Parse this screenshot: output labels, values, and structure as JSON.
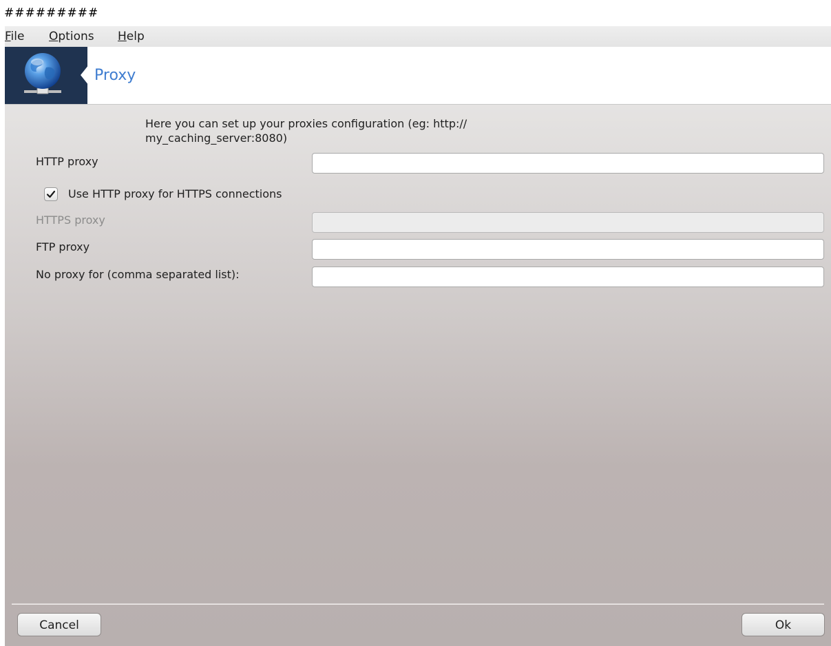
{
  "window_title": "#########",
  "menu": {
    "items": [
      {
        "label": "File",
        "mnemonic": "F"
      },
      {
        "label": "Options",
        "mnemonic": "O"
      },
      {
        "label": "Help",
        "mnemonic": "H"
      }
    ]
  },
  "banner": {
    "title": "Proxy",
    "icon": "network-globe-icon",
    "title_color": "#3f7dd0",
    "icon_bg_color": "#1f3350"
  },
  "description": {
    "line1": "Here you can set up your proxies configuration (eg: http://",
    "line2": "my_caching_server:8080)"
  },
  "fields": {
    "http_proxy": {
      "label": "HTTP proxy",
      "value": "",
      "placeholder": ""
    },
    "use_http_for_https": {
      "label": "Use HTTP proxy for HTTPS connections",
      "checked": true
    },
    "https_proxy": {
      "label": "HTTPS proxy",
      "value": "",
      "placeholder": "",
      "disabled": true
    },
    "ftp_proxy": {
      "label": "FTP proxy",
      "value": "",
      "placeholder": ""
    },
    "no_proxy": {
      "label": "No proxy for (comma separated list):",
      "value": "",
      "placeholder": ""
    }
  },
  "buttons": {
    "cancel": "Cancel",
    "ok": "Ok"
  }
}
